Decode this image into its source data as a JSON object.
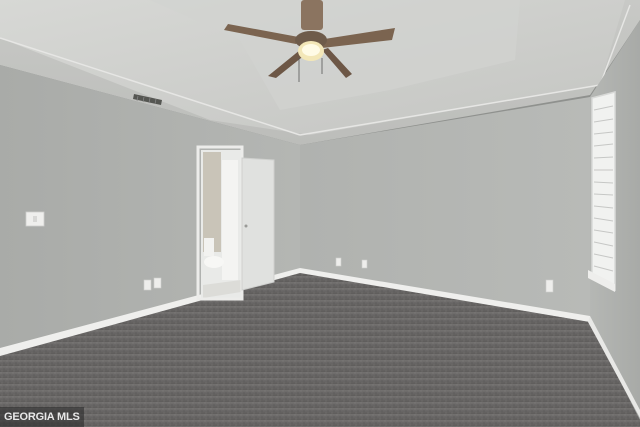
{
  "photo": {
    "watermark_text": "GEORGIA MLS",
    "colors": {
      "wall": "#b2b3b0",
      "wall_shadow": "#a3a5a2",
      "ceiling": "#cbccc9",
      "tray_ceiling": "#d6d7d4",
      "carpet": "#6a6867",
      "baseboard": "#eeeeec",
      "door": "#e2e3e1",
      "fan_blade": "#7b6450"
    },
    "icons": [
      "ceiling-fan-icon",
      "light-switch-icon",
      "outlet-icon",
      "air-vent-icon"
    ]
  }
}
